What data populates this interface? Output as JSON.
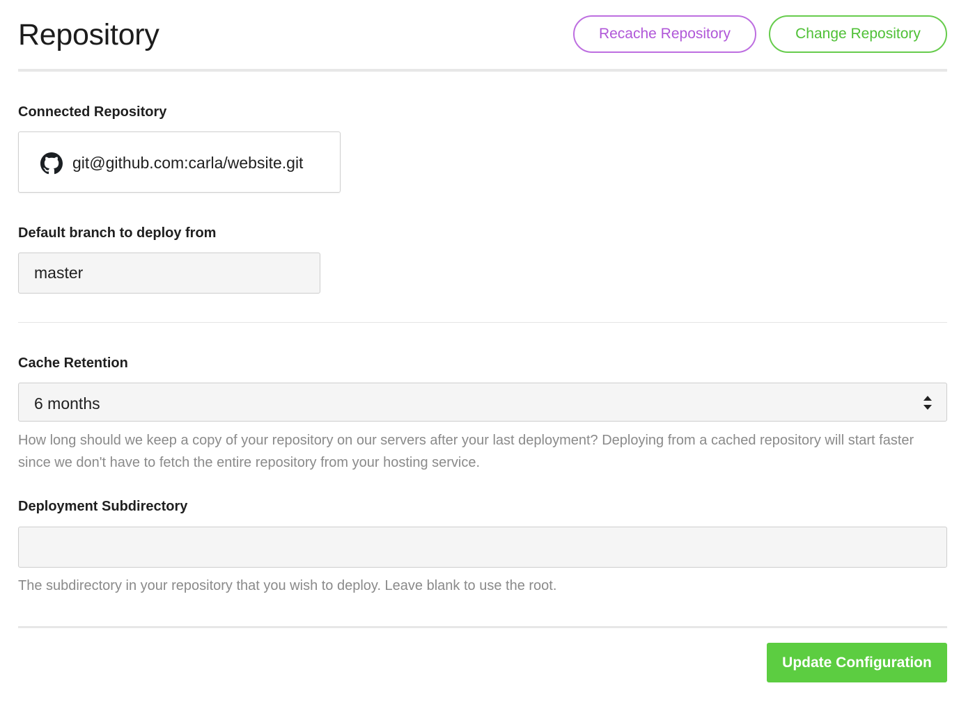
{
  "header": {
    "title": "Repository",
    "recache_label": "Recache Repository",
    "change_label": "Change Repository"
  },
  "connected_repository": {
    "label": "Connected Repository",
    "url": "git@github.com:carla/website.git",
    "icon": "github-icon"
  },
  "default_branch": {
    "label": "Default branch to deploy from",
    "value": "master"
  },
  "cache_retention": {
    "label": "Cache Retention",
    "selected": "6 months",
    "help": "How long should we keep a copy of your repository on our servers after your last deployment? Deploying from a cached repository will start faster since we don't have to fetch the entire repository from your hosting service."
  },
  "deployment_subdirectory": {
    "label": "Deployment Subdirectory",
    "value": "",
    "help": "The subdirectory in your repository that you wish to deploy. Leave blank to use the root."
  },
  "footer": {
    "update_label": "Update Configuration"
  },
  "colors": {
    "recache_accent": "#b057d8",
    "change_accent": "#4fc036",
    "primary_button": "#5ccd41"
  }
}
